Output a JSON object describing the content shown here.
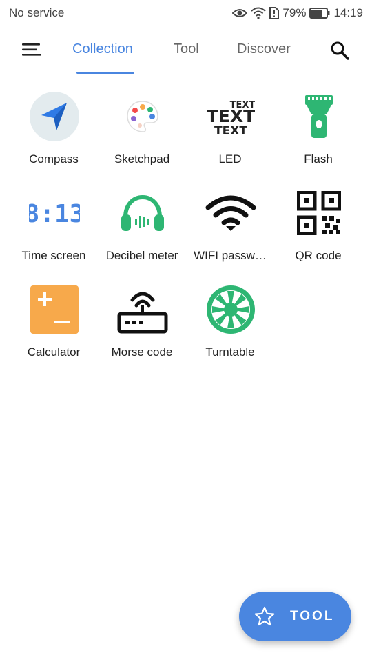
{
  "status_bar": {
    "carrier": "No service",
    "battery": "79%",
    "time": "14:19"
  },
  "header": {
    "tabs": [
      {
        "label": "Collection",
        "active": true
      },
      {
        "label": "Tool",
        "active": false
      },
      {
        "label": "Discover",
        "active": false
      }
    ]
  },
  "tools": [
    {
      "label": "Compass",
      "icon": "compass-icon"
    },
    {
      "label": "Sketchpad",
      "icon": "palette-icon"
    },
    {
      "label": "LED",
      "icon": "led-text-icon"
    },
    {
      "label": "Flash",
      "icon": "flashlight-icon"
    },
    {
      "label": "Time screen",
      "icon": "clock-digits-icon"
    },
    {
      "label": "Decibel meter",
      "icon": "headphones-icon"
    },
    {
      "label": "WIFI passw…",
      "icon": "wifi-icon"
    },
    {
      "label": "QR code",
      "icon": "qr-code-icon"
    },
    {
      "label": "Calculator",
      "icon": "calculator-icon"
    },
    {
      "label": "Morse code",
      "icon": "router-icon"
    },
    {
      "label": "Turntable",
      "icon": "wheel-icon"
    }
  ],
  "icon_text": {
    "led_lines": [
      "TEXT",
      "TEXT",
      "TEXT"
    ],
    "time_digits": "8:13"
  },
  "fab": {
    "label": "TOOL",
    "icon": "star-icon"
  },
  "colors": {
    "accent": "#4a86e0",
    "green": "#2eb673",
    "orange": "#f7a94b"
  }
}
